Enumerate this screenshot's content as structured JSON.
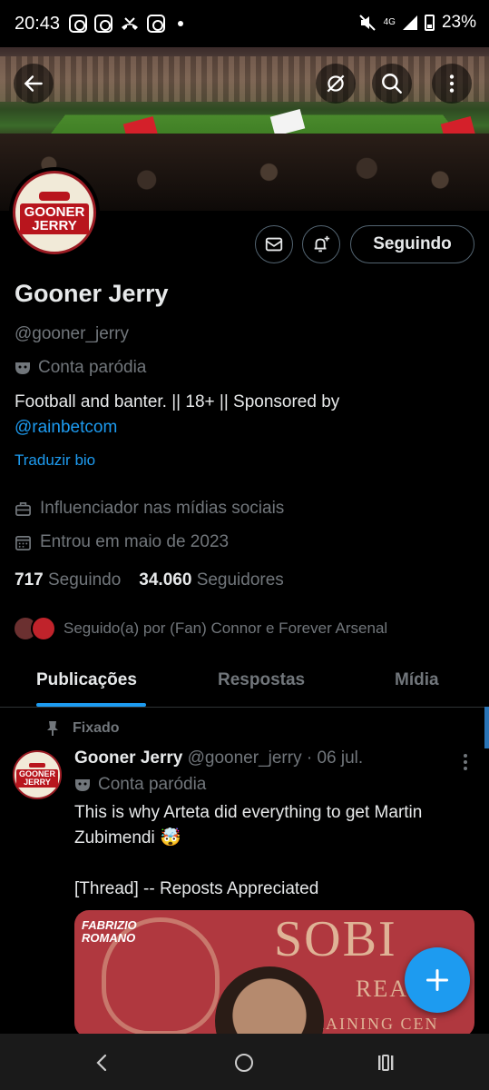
{
  "status_bar": {
    "time": "20:43",
    "network": "4G",
    "battery": "23%"
  },
  "header": {
    "back_icon": "arrow-left-icon",
    "translate_icon": "no-translate-icon",
    "search_icon": "search-icon",
    "more_icon": "more-vertical-icon"
  },
  "avatar": {
    "line1": "GOONER",
    "line2": "JERRY"
  },
  "actions": {
    "message_icon": "envelope-icon",
    "notify_icon": "bell-plus-icon",
    "follow_label": "Seguindo"
  },
  "profile": {
    "name": "Gooner Jerry",
    "handle": "@gooner_jerry",
    "parody_label": "Conta paródia",
    "bio_text": "Football and banter. || 18+ || Sponsored by",
    "bio_link": "@rainbetcom",
    "translate_bio": "Traduzir bio",
    "category": "Influenciador nas mídias sociais",
    "joined": "Entrou em maio de 2023",
    "following_count": "717",
    "following_label": "Seguindo",
    "followers_count": "34.060",
    "followers_label": "Seguidores",
    "followed_by": "Seguido(a) por (Fan) Connor e Forever Arsenal"
  },
  "tabs": [
    {
      "label": "Publicações",
      "active": true
    },
    {
      "label": "Respostas",
      "active": false
    },
    {
      "label": "Mídia",
      "active": false
    }
  ],
  "post": {
    "pinned_label": "Fixado",
    "author_name": "Gooner Jerry",
    "author_handle": "@gooner_jerry",
    "separator": "·",
    "date": "06 jul.",
    "parody_label": "Conta paródia",
    "text_line1": "This is why Arteta did everything to get Martin Zubimendi 🤯",
    "text_line2": "[Thread] -- Reposts Appreciated",
    "media": {
      "credit_line1": "FABRIZIO",
      "credit_line2": "ROMANO",
      "bg_word": "SOBI",
      "bg_word2": "REAL",
      "bg_word3": "TRAINING CEN"
    }
  },
  "fab_icon": "plus-icon",
  "colors": {
    "accent": "#1d9bf0",
    "background": "#000000",
    "muted": "#71767b",
    "text": "#e7e9ea",
    "arsenal_red": "#b8151d"
  }
}
